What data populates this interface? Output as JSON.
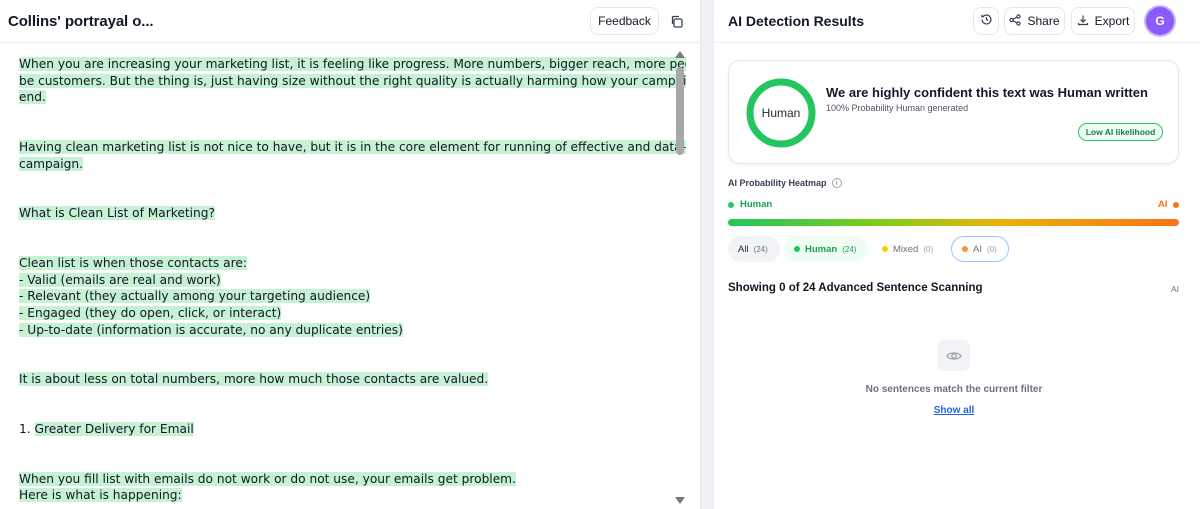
{
  "document": {
    "title": "Collins' portrayal o...",
    "feedback_label": "Feedback",
    "copy_icon": "copy-icon",
    "paragraphs": [
      {
        "lines": [
          [
            {
              "t": "When you are increasing your marketing list, it is feeling like progress. ",
              "h": true
            },
            {
              "t": "More numbers, bigger reach, more people that can",
              "h": true
            }
          ],
          [
            {
              "t": "be customers. ",
              "h": true
            },
            {
              "t": "But the thing is, just having size without the right quality is actually harming how your campaign does in the",
              "h": true
            }
          ],
          [
            {
              "t": "end.",
              "h": true
            }
          ]
        ]
      },
      {
        "lines": [
          [
            {
              "t": "Having clean marketing list is not nice to have, but it is in the core element for running of effective and data-driven ",
              "h": true
            }
          ],
          [
            {
              "t": "campaign.",
              "h": true
            }
          ]
        ]
      },
      {
        "lines": [
          [
            {
              "t": "What is Clean List of Marketing?",
              "h": true
            }
          ]
        ]
      },
      {
        "lines": [
          [
            {
              "t": "Clean list is when those contacts are:",
              "h": true
            }
          ],
          [
            {
              "t": "- Valid (emails are real and work)",
              "h": true
            }
          ],
          [
            {
              "t": "- Relevant (they actually among your targeting audience)",
              "h": true
            }
          ],
          [
            {
              "t": "- Engaged (they do open, click, or interact)",
              "h": true
            }
          ],
          [
            {
              "t": "- Up-to-date (information is accurate, no any duplicate entries)",
              "h": true
            }
          ]
        ]
      },
      {
        "lines": [
          [
            {
              "t": "It is about less on total numbers, more how much those contacts are valued.",
              "h": true
            }
          ]
        ]
      },
      {
        "lines": [
          [
            {
              "t": "1. ",
              "h": false
            },
            {
              "t": "Greater Delivery for Email",
              "h": true
            }
          ]
        ]
      },
      {
        "lines": [
          [
            {
              "t": "When you fill list with emails do not work or do not use, your emails get problem.",
              "h": true
            }
          ],
          [
            {
              "t": "Here is what is happening:",
              "h": true
            }
          ],
          [
            {
              "t": "                                                  ",
              "h": true
            }
          ]
        ]
      }
    ]
  },
  "results": {
    "title": "AI Detection Results",
    "history_icon": "history-icon",
    "share_label": "Share",
    "export_label": "Export",
    "avatar_initial": "G",
    "verdict_ring_label": "Human",
    "human_probability": 1.0,
    "verdict": "We are highly confident this text was Human written",
    "probability_text": "100% Probability Human generated",
    "likelihood_badge": "Low AI likelihood",
    "heatmap_label": "AI Probability Heatmap",
    "legend_human": "Human",
    "legend_ai": "AI",
    "filters": {
      "all_label": "All",
      "all_count": "(24)",
      "human_label": "Human",
      "human_count": "(24)",
      "mixed_label": "Mixed",
      "mixed_count": "(0)",
      "ai_label": "AI",
      "ai_count": "(0)"
    },
    "scan_title": "Showing 0 of 24 Advanced Sentence Scanning",
    "scan_ai_label": "AI",
    "empty_text": "No sentences match the current filter",
    "show_all": "Show all"
  },
  "colors": {
    "human_green": "#22c55e",
    "ai_orange": "#f97316",
    "mixed_yellow": "#facc15",
    "highlight": "#c6f1d3",
    "avatar_purple": "#8b5cf6"
  }
}
